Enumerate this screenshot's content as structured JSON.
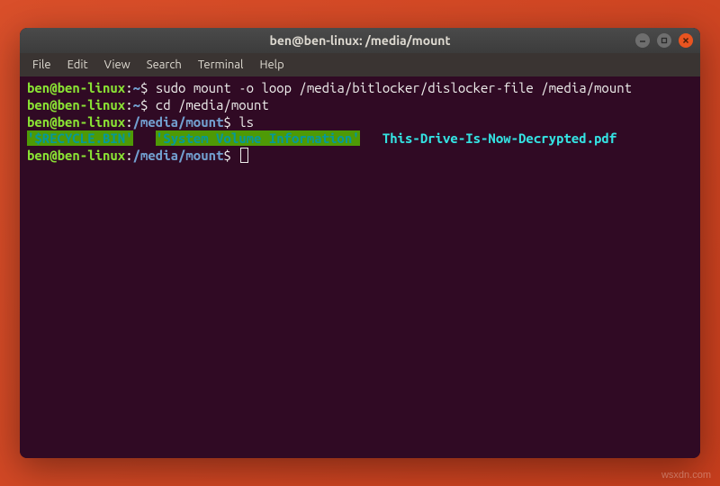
{
  "window": {
    "title": "ben@ben-linux: /media/mount"
  },
  "menubar": {
    "items": [
      "File",
      "Edit",
      "View",
      "Search",
      "Terminal",
      "Help"
    ]
  },
  "terminal": {
    "lines": [
      {
        "prompt": {
          "userhost": "ben@ben-linux",
          "path": "~"
        },
        "command": "sudo mount -o loop /media/bitlocker/dislocker-file /media/mount"
      },
      {
        "prompt": {
          "userhost": "ben@ben-linux",
          "path": "~"
        },
        "command": "cd /media/mount"
      },
      {
        "prompt": {
          "userhost": "ben@ben-linux",
          "path": "/media/mount"
        },
        "command": "ls"
      }
    ],
    "ls_output": {
      "highlighted1": "'$RECYCLE.BIN'",
      "highlighted2": "'System Volume Information'",
      "file1": "This-Drive-Is-Now-Decrypted.pdf"
    },
    "final_prompt": {
      "userhost": "ben@ben-linux",
      "path": "/media/mount"
    }
  },
  "watermark": "wsxdn.com"
}
